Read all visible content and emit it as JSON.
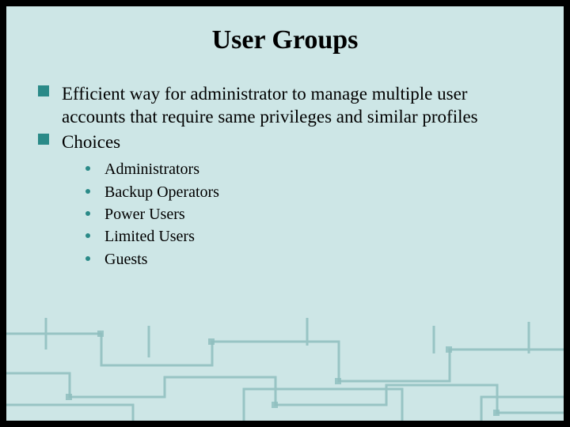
{
  "title": "User Groups",
  "colors": {
    "accent": "#2a8a88",
    "slide_bg": "#cde6e6",
    "text": "#000000"
  },
  "bullets": [
    {
      "text": "Efficient way for administrator to manage multiple user accounts that require same privileges and similar profiles"
    },
    {
      "text": "Choices",
      "children": [
        {
          "text": "Administrators"
        },
        {
          "text": "Backup Operators"
        },
        {
          "text": "Power Users"
        },
        {
          "text": "Limited Users"
        },
        {
          "text": "Guests"
        }
      ]
    }
  ]
}
